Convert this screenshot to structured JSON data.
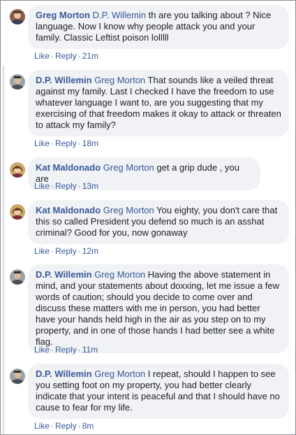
{
  "comments": [
    {
      "author": "Greg Morton",
      "mention": "D.P. Willemin",
      "text": " th are you talking about ? Nice language. Now I know why people attack you and your family. Classic Leftist poison lolllll",
      "like": "Like",
      "reply": "Reply",
      "time": "21m",
      "avatar": "greg-avatar"
    },
    {
      "author": "D.P. Willemin",
      "mention": "Greg Morton",
      "text": " That sounds like a veiled threat against my family. Last I checked I have the freedom to use whatever language I want to, are you suggesting that my exercising of that freedom makes it okay to attack or threaten to attack my family?",
      "like": "Like",
      "reply": "Reply",
      "time": "18m",
      "avatar": "dp-avatar"
    },
    {
      "author": "Kat Maldonado",
      "mention": "Greg Morton",
      "text": " get a grip dude , you are",
      "like": "Like",
      "reply": "Reply",
      "time": "13m",
      "avatar": "kat-avatar"
    },
    {
      "author": "Kat Maldonado",
      "mention": "Greg Morton",
      "text": " You eighty, you don't care that this so called President you defend so much is an asshat criminal? Good for you, now gonaway",
      "like": "Like",
      "reply": "Reply",
      "time": "12m",
      "avatar": "kat-avatar"
    },
    {
      "author": "D.P. Willemin",
      "mention": "Greg Morton",
      "text": " Having the above statement in mind, and your statements about doxxing, let me issue a few words of caution; should you decide to come over and discuss these matters with me in person, you had better have your hands held high in the air as you step on to my property, and in one of those hands I had better see a white flag.",
      "like": "Like",
      "reply": "Reply",
      "time": "11m",
      "avatar": "dp-avatar"
    },
    {
      "author": "D.P. Willemin",
      "mention": "Greg Morton",
      "text": " I repeat, should I happen to see you setting foot on my property, you had better clearly indicate that your intent is peaceful and that I should have no cause to fear for my life.",
      "like": "Like",
      "reply": "Reply",
      "time": "8m",
      "avatar": "dp-avatar"
    }
  ],
  "colors": {
    "link": "#385898",
    "bubble": "#f0f2f5",
    "text": "#1c1e21",
    "meta": "#606770"
  }
}
